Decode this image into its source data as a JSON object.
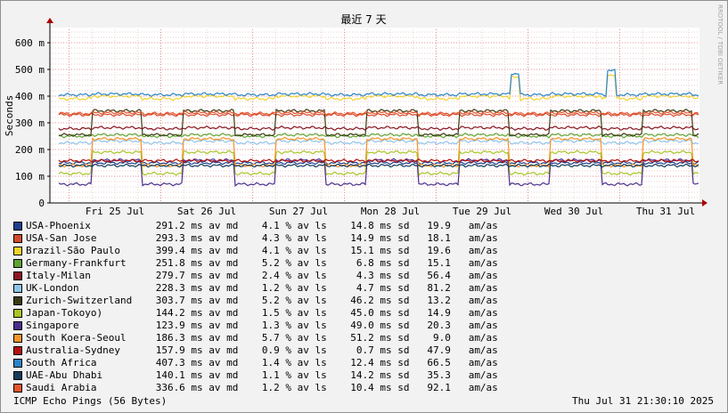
{
  "colors": {
    "background": "#f2f2f2",
    "plot_background": "#ffffff",
    "grid_minor": "#e8c8c8",
    "grid_major": "#e09090"
  },
  "chart_data": {
    "type": "line",
    "title": "最近 7 天",
    "ylabel": "Seconds",
    "watermark": "RRDTOOL / TOBI OETIKER",
    "y_unit_suffix": "m",
    "ylim": [
      0,
      650
    ],
    "y_ticks": [
      0,
      100,
      200,
      300,
      400,
      500,
      600
    ],
    "y_tick_labels": [
      "0",
      "100 m",
      "200 m",
      "300 m",
      "400 m",
      "500 m",
      "600 m"
    ],
    "x_tick_labels": [
      "Fri 25 Jul",
      "Sat 26 Jul",
      "Sun 27 Jul",
      "Mon 28 Jul",
      "Tue 29 Jul",
      "Wed 30 Jul",
      "Thu 31 Jul"
    ],
    "grid": true,
    "legend_position": "bottom",
    "series": [
      {
        "name": "USA-Phoenix",
        "color": "#1e3f8c",
        "avg": "291.2 ms av md",
        "loss": "4.1 % av ls",
        "sd": "14.8 ms sd",
        "amas": "19.9",
        "day": 150,
        "night": 150,
        "spike": false
      },
      {
        "name": "USA-San Jose",
        "color": "#d4492d",
        "avg": "293.3 ms av md",
        "loss": "4.3 % av ls",
        "sd": "14.9 ms sd",
        "amas": "18.1",
        "day": 330,
        "night": 330,
        "spike": false
      },
      {
        "name": "Brazil-São Paulo",
        "color": "#f3d22a",
        "avg": "399.4 ms av md",
        "loss": "4.1 % av ls",
        "sd": "15.1 ms sd",
        "amas": "19.6",
        "day": 400,
        "night": 390,
        "spike": true
      },
      {
        "name": "Germany-Frankfurt",
        "color": "#5fa332",
        "avg": "251.8 ms av md",
        "loss": "5.2 % av ls",
        "sd": "6.8 ms sd",
        "amas": "15.1",
        "day": 255,
        "night": 250,
        "spike": false
      },
      {
        "name": "Italy-Milan",
        "color": "#8c1623",
        "avg": "279.7 ms av md",
        "loss": "2.4 % av ls",
        "sd": "4.3 ms sd",
        "amas": "56.4",
        "day": 282,
        "night": 278,
        "spike": false
      },
      {
        "name": "UK-London",
        "color": "#8ec4ea",
        "avg": "228.3 ms av md",
        "loss": "1.2 % av ls",
        "sd": "4.7 ms sd",
        "amas": "81.2",
        "day": 232,
        "night": 225,
        "spike": false
      },
      {
        "name": "Zurich-Switzerland",
        "color": "#3a3d12",
        "avg": "303.7 ms av md",
        "loss": "5.2 % av ls",
        "sd": "46.2 ms sd",
        "amas": "13.2",
        "day": 345,
        "night": 255,
        "spike": false
      },
      {
        "name": "Japan-Tokoyo)",
        "color": "#a7c525",
        "avg": "144.2 ms av md",
        "loss": "1.5 % av ls",
        "sd": "45.0 ms sd",
        "amas": "14.9",
        "day": 190,
        "night": 110,
        "spike": false
      },
      {
        "name": "Singapore",
        "color": "#4b2e8c",
        "avg": "123.9 ms av md",
        "loss": "1.3 % av ls",
        "sd": "49.0 ms sd",
        "amas": "20.3",
        "day": 160,
        "night": 70,
        "spike": false
      },
      {
        "name": "South Koera-Seoul",
        "color": "#f5952a",
        "avg": "186.3 ms av md",
        "loss": "5.7 % av ls",
        "sd": "51.2 ms sd",
        "amas": "9.0",
        "day": 240,
        "night": 140,
        "spike": false
      },
      {
        "name": "Australia-Sydney",
        "color": "#b5110e",
        "avg": "157.9 ms av md",
        "loss": "0.9 % av ls",
        "sd": "0.7 ms sd",
        "amas": "47.9",
        "day": 158,
        "night": 158,
        "spike": false
      },
      {
        "name": "South Africa",
        "color": "#2a84c8",
        "avg": "407.3 ms av md",
        "loss": "1.4 % av ls",
        "sd": "12.4 ms sd",
        "amas": "66.5",
        "day": 408,
        "night": 405,
        "spike": true
      },
      {
        "name": "UAE-Abu Dhabi",
        "color": "#133c5c",
        "avg": "140.1 ms av md",
        "loss": "1.1 % av ls",
        "sd": "14.2 ms sd",
        "amas": "35.3",
        "day": 140,
        "night": 140,
        "spike": false
      },
      {
        "name": "Saudi Arabia",
        "color": "#e5542b",
        "avg": "336.6 ms av md",
        "loss": "1.2 % av ls",
        "sd": "10.4 ms sd",
        "amas": "92.1",
        "day": 338,
        "night": 335,
        "spike": false
      }
    ],
    "amas_unit": "am/as"
  },
  "footer": {
    "left": "ICMP Echo Pings (56 Bytes)",
    "right": "Thu Jul 31 21:30:10 2025"
  }
}
